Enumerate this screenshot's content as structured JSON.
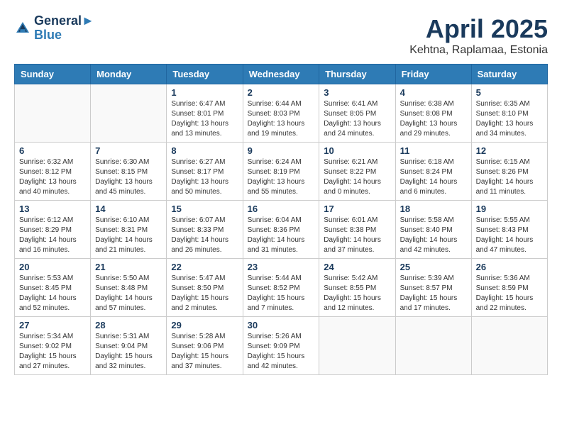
{
  "logo": {
    "line1": "General",
    "line2": "Blue"
  },
  "title": "April 2025",
  "location": "Kehtna, Raplamaa, Estonia",
  "weekdays": [
    "Sunday",
    "Monday",
    "Tuesday",
    "Wednesday",
    "Thursday",
    "Friday",
    "Saturday"
  ],
  "weeks": [
    [
      {
        "day": "",
        "info": ""
      },
      {
        "day": "",
        "info": ""
      },
      {
        "day": "1",
        "info": "Sunrise: 6:47 AM\nSunset: 8:01 PM\nDaylight: 13 hours\nand 13 minutes."
      },
      {
        "day": "2",
        "info": "Sunrise: 6:44 AM\nSunset: 8:03 PM\nDaylight: 13 hours\nand 19 minutes."
      },
      {
        "day": "3",
        "info": "Sunrise: 6:41 AM\nSunset: 8:05 PM\nDaylight: 13 hours\nand 24 minutes."
      },
      {
        "day": "4",
        "info": "Sunrise: 6:38 AM\nSunset: 8:08 PM\nDaylight: 13 hours\nand 29 minutes."
      },
      {
        "day": "5",
        "info": "Sunrise: 6:35 AM\nSunset: 8:10 PM\nDaylight: 13 hours\nand 34 minutes."
      }
    ],
    [
      {
        "day": "6",
        "info": "Sunrise: 6:32 AM\nSunset: 8:12 PM\nDaylight: 13 hours\nand 40 minutes."
      },
      {
        "day": "7",
        "info": "Sunrise: 6:30 AM\nSunset: 8:15 PM\nDaylight: 13 hours\nand 45 minutes."
      },
      {
        "day": "8",
        "info": "Sunrise: 6:27 AM\nSunset: 8:17 PM\nDaylight: 13 hours\nand 50 minutes."
      },
      {
        "day": "9",
        "info": "Sunrise: 6:24 AM\nSunset: 8:19 PM\nDaylight: 13 hours\nand 55 minutes."
      },
      {
        "day": "10",
        "info": "Sunrise: 6:21 AM\nSunset: 8:22 PM\nDaylight: 14 hours\nand 0 minutes."
      },
      {
        "day": "11",
        "info": "Sunrise: 6:18 AM\nSunset: 8:24 PM\nDaylight: 14 hours\nand 6 minutes."
      },
      {
        "day": "12",
        "info": "Sunrise: 6:15 AM\nSunset: 8:26 PM\nDaylight: 14 hours\nand 11 minutes."
      }
    ],
    [
      {
        "day": "13",
        "info": "Sunrise: 6:12 AM\nSunset: 8:29 PM\nDaylight: 14 hours\nand 16 minutes."
      },
      {
        "day": "14",
        "info": "Sunrise: 6:10 AM\nSunset: 8:31 PM\nDaylight: 14 hours\nand 21 minutes."
      },
      {
        "day": "15",
        "info": "Sunrise: 6:07 AM\nSunset: 8:33 PM\nDaylight: 14 hours\nand 26 minutes."
      },
      {
        "day": "16",
        "info": "Sunrise: 6:04 AM\nSunset: 8:36 PM\nDaylight: 14 hours\nand 31 minutes."
      },
      {
        "day": "17",
        "info": "Sunrise: 6:01 AM\nSunset: 8:38 PM\nDaylight: 14 hours\nand 37 minutes."
      },
      {
        "day": "18",
        "info": "Sunrise: 5:58 AM\nSunset: 8:40 PM\nDaylight: 14 hours\nand 42 minutes."
      },
      {
        "day": "19",
        "info": "Sunrise: 5:55 AM\nSunset: 8:43 PM\nDaylight: 14 hours\nand 47 minutes."
      }
    ],
    [
      {
        "day": "20",
        "info": "Sunrise: 5:53 AM\nSunset: 8:45 PM\nDaylight: 14 hours\nand 52 minutes."
      },
      {
        "day": "21",
        "info": "Sunrise: 5:50 AM\nSunset: 8:48 PM\nDaylight: 14 hours\nand 57 minutes."
      },
      {
        "day": "22",
        "info": "Sunrise: 5:47 AM\nSunset: 8:50 PM\nDaylight: 15 hours\nand 2 minutes."
      },
      {
        "day": "23",
        "info": "Sunrise: 5:44 AM\nSunset: 8:52 PM\nDaylight: 15 hours\nand 7 minutes."
      },
      {
        "day": "24",
        "info": "Sunrise: 5:42 AM\nSunset: 8:55 PM\nDaylight: 15 hours\nand 12 minutes."
      },
      {
        "day": "25",
        "info": "Sunrise: 5:39 AM\nSunset: 8:57 PM\nDaylight: 15 hours\nand 17 minutes."
      },
      {
        "day": "26",
        "info": "Sunrise: 5:36 AM\nSunset: 8:59 PM\nDaylight: 15 hours\nand 22 minutes."
      }
    ],
    [
      {
        "day": "27",
        "info": "Sunrise: 5:34 AM\nSunset: 9:02 PM\nDaylight: 15 hours\nand 27 minutes."
      },
      {
        "day": "28",
        "info": "Sunrise: 5:31 AM\nSunset: 9:04 PM\nDaylight: 15 hours\nand 32 minutes."
      },
      {
        "day": "29",
        "info": "Sunrise: 5:28 AM\nSunset: 9:06 PM\nDaylight: 15 hours\nand 37 minutes."
      },
      {
        "day": "30",
        "info": "Sunrise: 5:26 AM\nSunset: 9:09 PM\nDaylight: 15 hours\nand 42 minutes."
      },
      {
        "day": "",
        "info": ""
      },
      {
        "day": "",
        "info": ""
      },
      {
        "day": "",
        "info": ""
      }
    ]
  ]
}
